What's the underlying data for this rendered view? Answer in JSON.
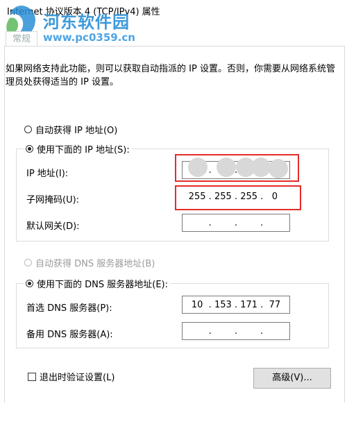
{
  "window": {
    "title": "Internet 协议版本 4 (TCP/IPv4) 属性"
  },
  "watermark": {
    "name": "河东软件园",
    "url": "www.pc0359.cn"
  },
  "tab": {
    "label": "常规"
  },
  "description": "如果网络支持此功能，则可以获取自动指派的 IP 设置。否则，你需要从网络系统管理员处获得适当的 IP 设置。",
  "ip": {
    "auto_label": "自动获得 IP 地址(O)",
    "auto_checked": false,
    "manual_label": "使用下面的 IP 地址(S):",
    "manual_checked": true,
    "address_label": "IP 地址(I):",
    "address_octets": [
      "",
      "",
      "",
      ""
    ],
    "subnet_label": "子网掩码(U):",
    "subnet_octets": [
      "255",
      "255",
      "255",
      "0"
    ],
    "gateway_label": "默认网关(D):",
    "gateway_octets": [
      "",
      "",
      "",
      ""
    ]
  },
  "dns": {
    "auto_label": "自动获得 DNS 服务器地址(B)",
    "auto_checked": false,
    "auto_disabled": true,
    "manual_label": "使用下面的 DNS 服务器地址(E):",
    "manual_checked": true,
    "preferred_label": "首选 DNS 服务器(P):",
    "preferred_octets": [
      "10",
      "153",
      "171",
      "77"
    ],
    "alternate_label": "备用 DNS 服务器(A):",
    "alternate_octets": [
      "",
      "",
      "",
      ""
    ]
  },
  "validate": {
    "label": "退出时验证设置(L)",
    "checked": false
  },
  "buttons": {
    "advanced_label": "高级(V)..."
  },
  "colors": {
    "highlight_border": "#e32b2b",
    "watermark_blue": "#2a8fd6"
  }
}
